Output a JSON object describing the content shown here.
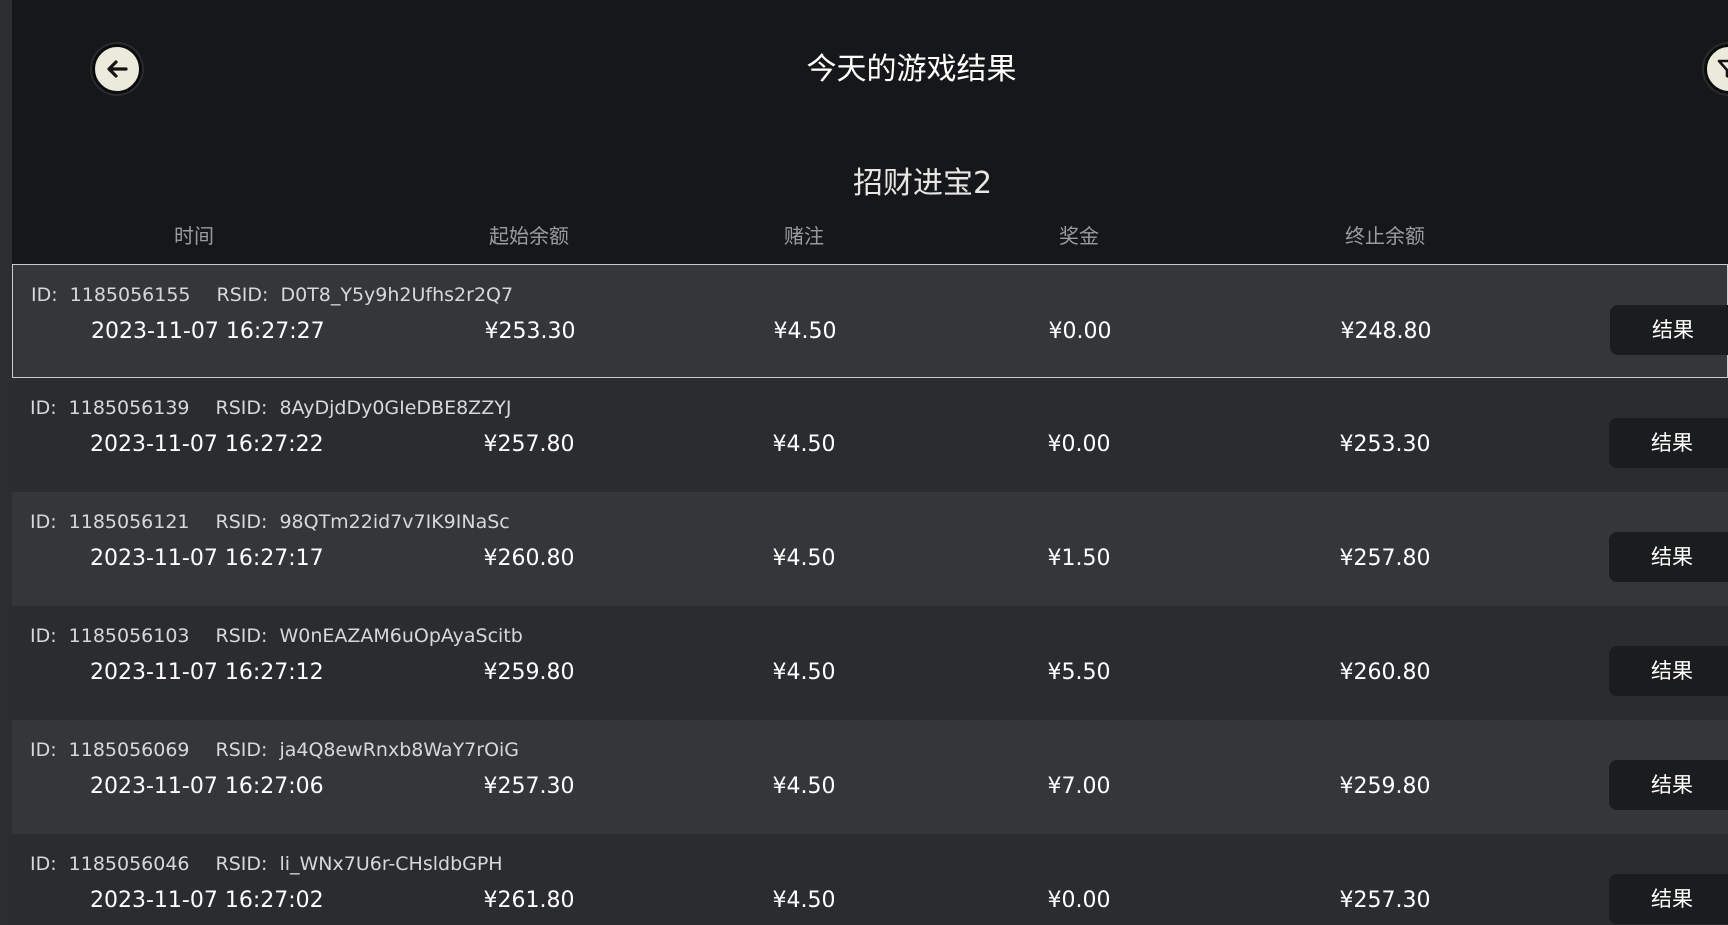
{
  "header": {
    "title": "今天的游戏结果",
    "back_icon": "arrow-left-icon",
    "filter_icon": "filter-icon"
  },
  "game": {
    "name": "招财进宝2"
  },
  "columns": [
    "时间",
    "起始余额",
    "赌注",
    "奖金",
    "终止余额"
  ],
  "labels": {
    "id": "ID:",
    "rsid": "RSID:",
    "result_button": "结果"
  },
  "colors": {
    "background": "#161719",
    "row_odd": "#333739",
    "row_even": "#2a2c2f",
    "button_bg": "#1b1c1e",
    "icon_button_bg": "#ecebdb"
  },
  "rows": [
    {
      "id": "1185056155",
      "rsid": "D0T8_Y5y9h2Ufhs2r2Q7",
      "time": "2023-11-07 16:27:27",
      "start": "¥253.30",
      "bet": "¥4.50",
      "win": "¥0.00",
      "end": "¥248.80"
    },
    {
      "id": "1185056139",
      "rsid": "8AyDjdDy0GIeDBE8ZZYJ",
      "time": "2023-11-07 16:27:22",
      "start": "¥257.80",
      "bet": "¥4.50",
      "win": "¥0.00",
      "end": "¥253.30"
    },
    {
      "id": "1185056121",
      "rsid": "98QTm22id7v7IK9INaSc",
      "time": "2023-11-07 16:27:17",
      "start": "¥260.80",
      "bet": "¥4.50",
      "win": "¥1.50",
      "end": "¥257.80"
    },
    {
      "id": "1185056103",
      "rsid": "W0nEAZAM6uOpAyaScitb",
      "time": "2023-11-07 16:27:12",
      "start": "¥259.80",
      "bet": "¥4.50",
      "win": "¥5.50",
      "end": "¥260.80"
    },
    {
      "id": "1185056069",
      "rsid": "ja4Q8ewRnxb8WaY7rOiG",
      "time": "2023-11-07 16:27:06",
      "start": "¥257.30",
      "bet": "¥4.50",
      "win": "¥7.00",
      "end": "¥259.80"
    },
    {
      "id": "1185056046",
      "rsid": "li_WNx7U6r-CHsldbGPH",
      "time": "2023-11-07 16:27:02",
      "start": "¥261.80",
      "bet": "¥4.50",
      "win": "¥0.00",
      "end": "¥257.30"
    }
  ]
}
